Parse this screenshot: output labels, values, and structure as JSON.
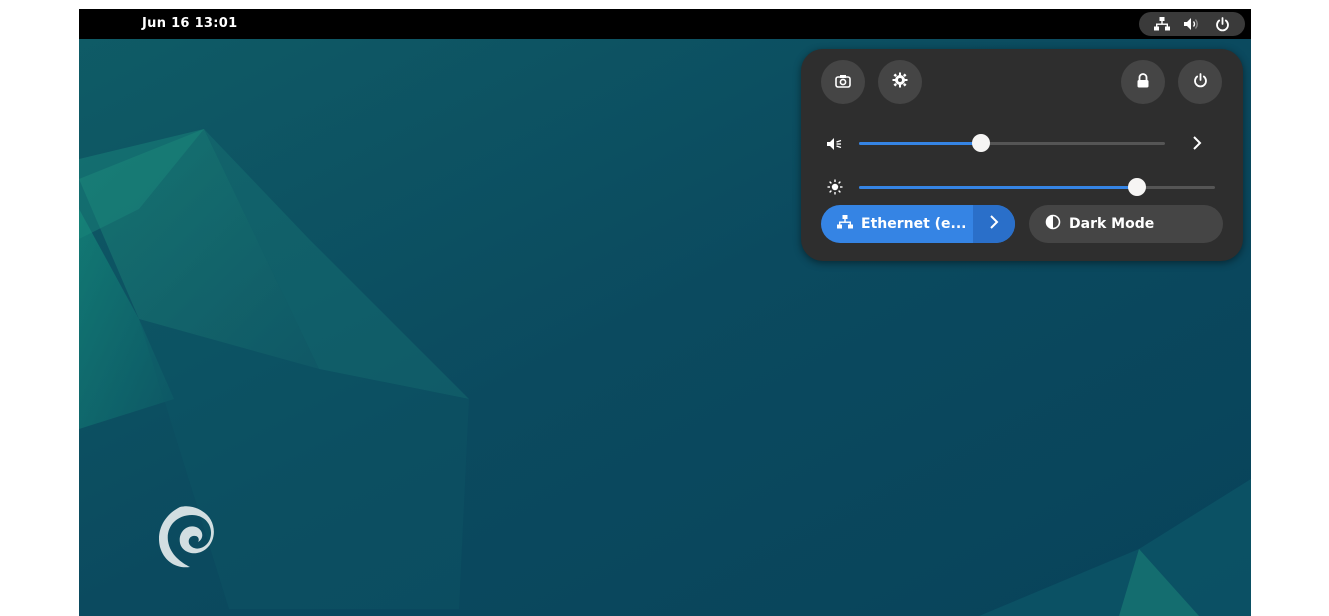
{
  "topbar": {
    "datetime": "Jun 16  13:01",
    "tray_icons": [
      "network-wired-icon",
      "volume-icon",
      "power-icon"
    ]
  },
  "quick_settings": {
    "top_buttons_left": [
      "screenshot-icon",
      "settings-icon"
    ],
    "top_buttons_right": [
      "lock-icon",
      "power-off-icon"
    ],
    "volume": {
      "level": 0.4,
      "icon": "speaker-muted-icon",
      "has_expand_arrow": true
    },
    "brightness": {
      "level": 0.78,
      "icon": "sun-icon"
    },
    "network_toggle": {
      "label": "Ethernet (e...",
      "active": true,
      "icon": "network-wired-icon"
    },
    "dark_mode_toggle": {
      "label": "Dark Mode",
      "active": false,
      "icon": "contrast-icon"
    }
  },
  "colors": {
    "accent": "#3584e4",
    "panel_bg": "#2e2e2e",
    "button_bg": "#454545",
    "wallpaper": "#0d4a5e",
    "topbar": "#000000"
  },
  "desktop": {
    "logo": "debian-swirl-logo"
  }
}
